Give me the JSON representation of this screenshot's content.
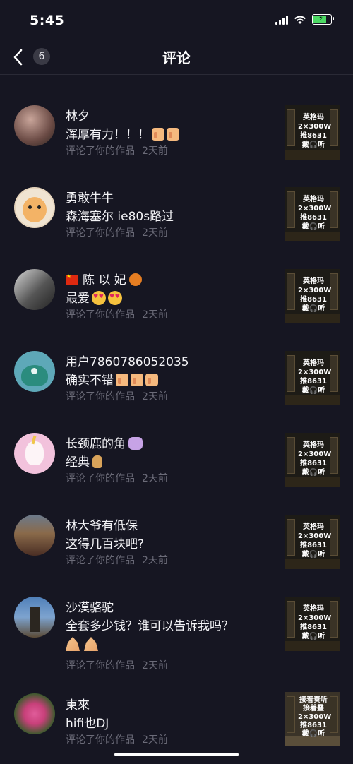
{
  "status_bar": {
    "time": "5:45"
  },
  "nav": {
    "title": "评论",
    "badge_count": "6"
  },
  "rows": [
    {
      "name": "林夕",
      "comment": "浑厚有力！！！",
      "meta_action": "评论了你的作品",
      "meta_time": "2天前",
      "thumb_lines": [
        "英格玛",
        "2×300W",
        "推8631",
        "戴🎧听"
      ]
    },
    {
      "name": "勇敢牛牛",
      "comment": "森海塞尔 ie80s路过",
      "meta_action": "评论了你的作品",
      "meta_time": "2天前",
      "thumb_lines": [
        "英格玛",
        "2×300W",
        "推8631",
        "戴🎧听"
      ]
    },
    {
      "name": "陈 以 妃",
      "comment": "最爱",
      "meta_action": "评论了你的作品",
      "meta_time": "2天前",
      "thumb_lines": [
        "英格玛",
        "2×300W",
        "推8631",
        "戴🎧听"
      ]
    },
    {
      "name": "用户7860786052035",
      "comment": "确实不错",
      "meta_action": "评论了你的作品",
      "meta_time": "2天前",
      "thumb_lines": [
        "英格玛",
        "2×300W",
        "推8631",
        "戴🎧听"
      ]
    },
    {
      "name": "长颈鹿的角",
      "comment": "经典",
      "meta_action": "评论了你的作品",
      "meta_time": "2天前",
      "thumb_lines": [
        "英格玛",
        "2×300W",
        "推8631",
        "戴🎧听"
      ]
    },
    {
      "name": "林大爷有低保",
      "comment": "这得几百块吧?",
      "meta_action": "评论了你的作品",
      "meta_time": "2天前",
      "thumb_lines": [
        "英格玛",
        "2×300W",
        "推8631",
        "戴🎧听"
      ]
    },
    {
      "name": "沙漠骆驼",
      "comment": "全套多少钱？谁可以告诉我吗？",
      "meta_action": "评论了你的作品",
      "meta_time": "2天前",
      "thumb_lines": [
        "英格玛",
        "2×300W",
        "推8631",
        "戴🎧听"
      ]
    },
    {
      "name": "東來",
      "comment": "hifi也DJ",
      "meta_action": "评论了你的作品",
      "meta_time": "2天前",
      "thumb_lines": [
        "接着奏听",
        "接着叠",
        "2×300W",
        "推8631",
        "戴🎧听"
      ]
    }
  ],
  "colors": {
    "background": "#161622",
    "meta_text": "#6b6b78"
  }
}
